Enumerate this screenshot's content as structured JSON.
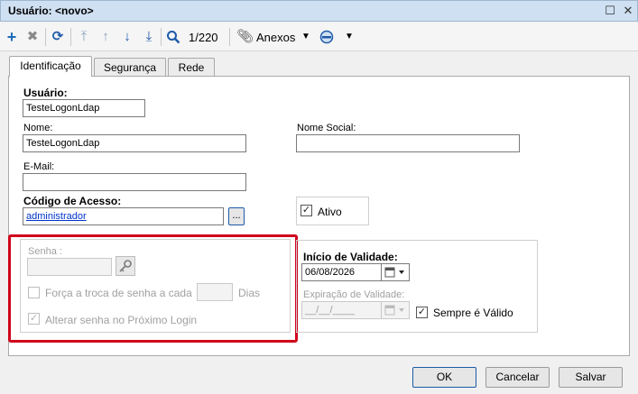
{
  "window": {
    "title": "Usuário: <novo>",
    "minimize_glyph": "☐",
    "close_glyph": "✕"
  },
  "toolbar": {
    "record_position": "1/220",
    "attachments_label": "Anexos",
    "icons": [
      "add-icon",
      "delete-icon",
      "refresh-icon",
      "first-record-icon",
      "previous-record-icon",
      "next-record-icon",
      "last-record-icon",
      "search-icon",
      "paperclip-icon",
      "dropdown-arrow-icon",
      "database-icon",
      "dropdown-arrow-icon"
    ]
  },
  "tabs": [
    {
      "label": "Identificação",
      "active": true
    },
    {
      "label": "Segurança",
      "active": false
    },
    {
      "label": "Rede",
      "active": false
    }
  ],
  "form": {
    "usuario_label": "Usuário:",
    "usuario_value": "TesteLogonLdap",
    "nome_label": "Nome:",
    "nome_value": "TesteLogonLdap",
    "nome_social_label": "Nome Social:",
    "nome_social_value": "",
    "email_label": "E-Mail:",
    "email_value": "",
    "codigo_acesso_label": "Código de Acesso:",
    "codigo_acesso_value": "administrador",
    "browse_label": "...",
    "ativo_label": "Ativo",
    "ativo_checked": true,
    "senha_label": "Senha :",
    "senha_value": "",
    "forca_troca_label": "Força a troca de senha a cada",
    "forca_troca_checked": false,
    "dias_value": "",
    "dias_label": "Dias",
    "alterar_senha_label": "Alterar senha no Próximo Login",
    "alterar_senha_checked": true,
    "inicio_validade_label": "Início de Validade:",
    "inicio_validade_value": "06/08/2026",
    "expiracao_label": "Expiração de Validade:",
    "expiracao_value": "__/__/____",
    "sempre_valido_label": "Sempre é Válido",
    "sempre_valido_checked": true
  },
  "buttons": {
    "ok": "OK",
    "cancelar": "Cancelar",
    "salvar": "Salvar"
  },
  "colors": {
    "highlight_box": "#d0021b",
    "accent_blue": "#1e5aa8",
    "titlebar": "#cfe0f2"
  }
}
